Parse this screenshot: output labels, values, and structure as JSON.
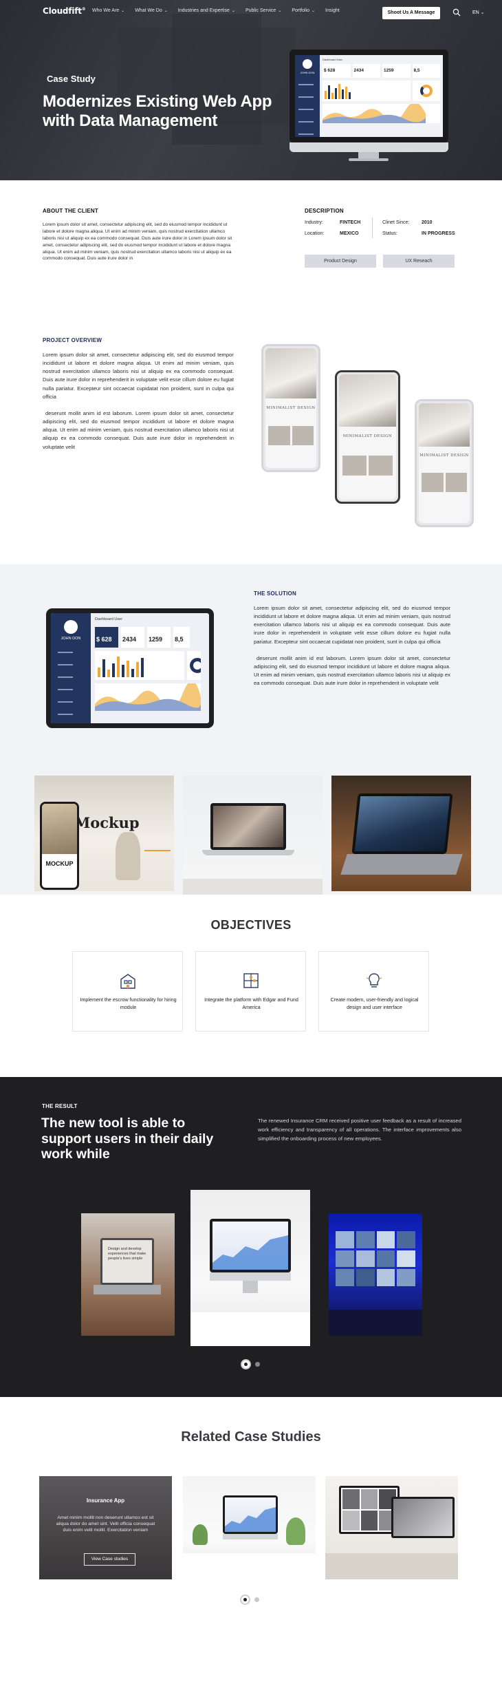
{
  "nav": {
    "logo": "Cloudfift",
    "links": [
      {
        "label": "Who We Are"
      },
      {
        "label": "What We Do"
      },
      {
        "label": "Industries and Expertise"
      },
      {
        "label": "Public Service"
      },
      {
        "label": "Portfolio"
      },
      {
        "label": "Insight"
      }
    ],
    "cta": "Shoot Us A Message",
    "lang": "EN"
  },
  "hero": {
    "tag": "Case Study",
    "title": "Modernizes Existing Web App with Data Management"
  },
  "dashboard": {
    "header": "Dashboard User",
    "user": "JOHN DON",
    "stats": [
      "$ 628",
      "2434",
      "1259",
      "8,5"
    ]
  },
  "about": {
    "title": "ABOUT THE CLIENT",
    "text": "Lorem ipsum dolor sit amet, consectetur adipiscing elit, sed do eiusmod tempor incididunt ut labore et dolore magna aliqua. Ut enim ad minim veniam, quis nostrud exercitation ullamco laboris nisi ut aliquip ex ea commodo consequat. Duis aute irure dolor in Lorem ipsum dolor sit amet, consectetur adipiscing elit, sed do eiusmod tempor incididunt ut labore et dolore magna aliqua. Ut enim ad minim veniam, quis nostrud exercitation ullamco laboris nisi ut aliquip ex ea commodo consequat. Duis aute irure dolor in"
  },
  "description": {
    "title": "DESCRIPTION",
    "industry_label": "Industry:",
    "industry": "FINTECH",
    "location_label": "Location:",
    "location": "MEXICO",
    "since_label": "Clinet Since:",
    "since": "2010",
    "status_label": "Status:",
    "status": "IN PROGRESS",
    "tags": [
      "Product Design",
      "UX Reseach"
    ]
  },
  "overview": {
    "title": "PROJECT OVERVIEW",
    "p1": "Lorem ipsum dolor sit amet, consectetur adipiscing elit, sed do eiusmod tempor incididunt ut labore et dolore magna aliqua. Ut enim ad minim veniam, quis nostrud exercitation ullamco laboris nisi ut aliquip ex ea commodo consequat. Duis aute irure dolor in reprehenderit in voluptate velit esse cillum dolore eu fugiat nulla pariatur. Excepteur sint occaecat cupidatat non proident, sunt in culpa qui officia",
    "p2": "deserunt mollit anim id est laborum. Lorem ipsum dolor sit amet, consectetur adipiscing elit, sed do eiusmod tempor incididunt ut labore et dolore magna aliqua. Ut enim ad minim veniam, quis nostrud exercitation ullamco laboris nisi ut aliquip ex ea commodo consequat. Duis aute irure dolor in reprehenderit in voluptate velit",
    "phone_brand": "MINIMALIST DESIGN"
  },
  "solution": {
    "title": "THE SOLUTION",
    "p1": "Lorem ipsum dolor sit amet, consectetur adipiscing elit, sed do eiusmod tempor incididunt ut labore et dolore magna aliqua. Ut enim ad minim veniam, quis nostrud exercitation ullamco laboris nisi ut aliquip ex ea commodo consequat. Duis aute irure dolor in reprehenderit in voluptate velit esse cillum dolore eu fugiat nulla pariatur. Excepteur sint occaecat cupidatat non proident, sunt in culpa qui officia",
    "p2": "deserunt mollit anim id est laborum. Lorem ipsum dolor sit amet, consectetur adipiscing elit, sed do eiusmod tempor incididunt ut labore et dolore magna aliqua. Ut enim ad minim veniam, quis nostrud exercitation ullamco laboris nisi ut aliquip ex ea commodo consequat. Duis aute irure dolor in reprehenderit in voluptate velit",
    "mockup_title": "Mockup",
    "mockup_phone": "MOCKUP"
  },
  "objectives": {
    "title": "OBJECTIVES",
    "items": [
      {
        "text": "Implement the escrow functionality for hiring module",
        "icon": "building-icon"
      },
      {
        "text": "Integrate the platform with Edgar and Fund America",
        "icon": "puzzle-icon"
      },
      {
        "text": "Create modern, user-friendly and logical design and user interface",
        "icon": "lightbulb-icon"
      }
    ]
  },
  "result": {
    "tag": "THE RESULT",
    "title": "The new tool is able to support users in their daily work while",
    "text": "The renewed Insurance CRM received positive user feedback as a result of increased work efficiency and transparency of all operations. The interface improvements also simplified the onboarding process of new employees.",
    "laptop_note": "Design and develop experiences that make people's lives simple"
  },
  "related": {
    "title": "Related Case Studies",
    "card_title": "Insurance App",
    "card_text": "Amet minim mollit non deserunt ullamco est sit aliqua dolor do amet sint. Velit officia consequat duis enim velit mollit. Exercitation veniam",
    "card_button": "View Case studies"
  },
  "colors": {
    "navy": "#22355e",
    "dark": "#1f1e21",
    "accent": "#f2a93b"
  }
}
